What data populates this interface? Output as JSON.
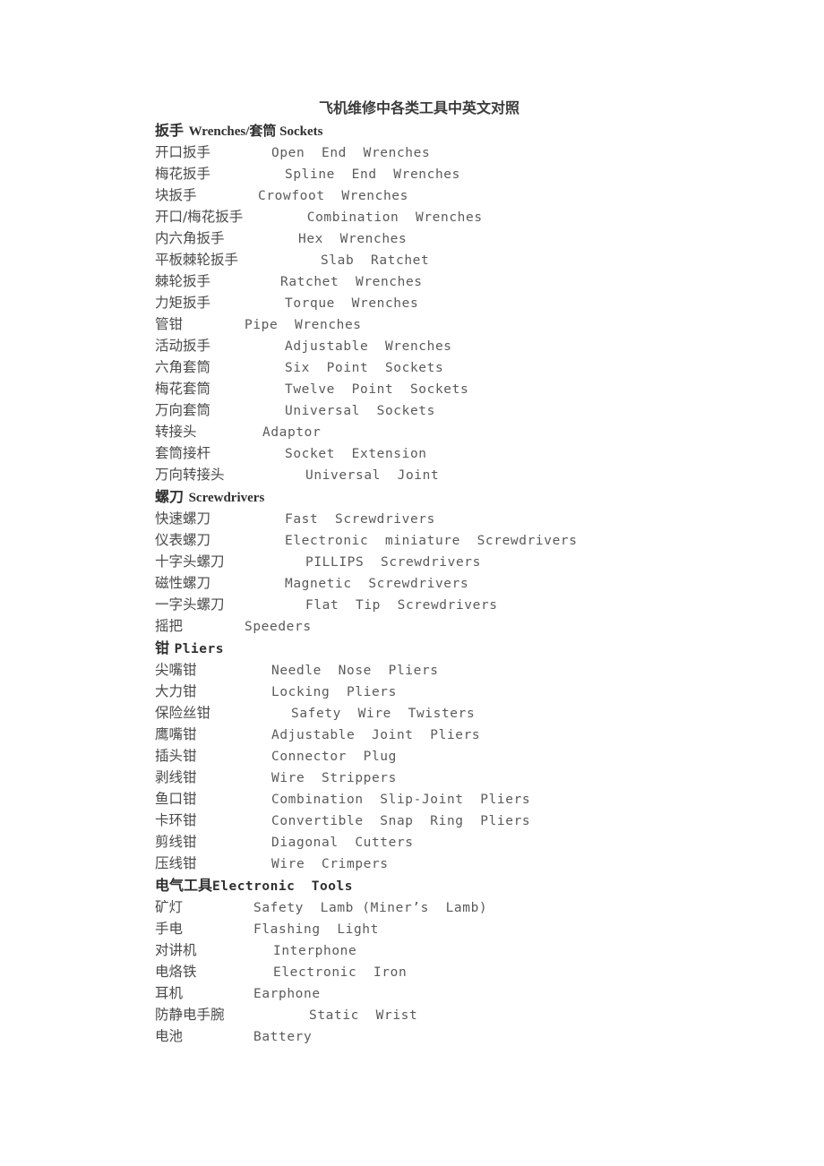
{
  "document": {
    "title": "飞机维修中各类工具中英文对照",
    "sections": [
      {
        "id": "wrenches-sockets",
        "heading_cn": "扳手 ",
        "heading_en": "Wrenches/套筒 Sockets",
        "heading_mono": false,
        "entries": [
          {
            "cn": "开口扳手",
            "en": "Open  End  Wrenches",
            "indent": 130
          },
          {
            "cn": "梅花扳手",
            "en": "Spline  End  Wrenches",
            "indent": 145
          },
          {
            "cn": "块扳手",
            "en": "Crowfoot  Wrenches",
            "indent": 115
          },
          {
            "cn": "开口/梅花扳手",
            "en": "Combination  Wrenches",
            "indent": 180
          },
          {
            "cn": "内六角扳手",
            "en": "Hex  Wrenches",
            "indent": 160
          },
          {
            "cn": "平板棘轮扳手",
            "en": "Slab  Ratchet",
            "indent": 185
          },
          {
            "cn": "棘轮扳手",
            "en": "Ratchet  Wrenches",
            "indent": 140
          },
          {
            "cn": "力矩扳手",
            "en": "Torque  Wrenches",
            "indent": 145
          },
          {
            "cn": "管钳",
            "en": "Pipe  Wrenches",
            "indent": 100
          },
          {
            "cn": "活动扳手",
            "en": "Adjustable  Wrenches",
            "indent": 145
          },
          {
            "cn": "六角套筒",
            "en": "Six  Point  Sockets",
            "indent": 145
          },
          {
            "cn": "梅花套筒",
            "en": "Twelve  Point  Sockets",
            "indent": 145
          },
          {
            "cn": "万向套筒",
            "en": "Universal  Sockets",
            "indent": 145
          },
          {
            "cn": "转接头",
            "en": "Adaptor",
            "indent": 120
          },
          {
            "cn": "套筒接杆",
            "en": "Socket  Extension",
            "indent": 145
          },
          {
            "cn": "万向转接头",
            "en": "Universal  Joint",
            "indent": 168
          }
        ]
      },
      {
        "id": "screwdrivers",
        "heading_cn": "螺刀 ",
        "heading_en": "Screwdrivers",
        "heading_mono": false,
        "entries": [
          {
            "cn": "快速螺刀",
            "en": "Fast  Screwdrivers",
            "indent": 145
          },
          {
            "cn": "仪表螺刀",
            "en": "Electronic  miniature  Screwdrivers",
            "indent": 145
          },
          {
            "cn": "十字头螺刀",
            "en": "PILLIPS  Screwdrivers",
            "indent": 168
          },
          {
            "cn": "磁性螺刀",
            "en": "Magnetic  Screwdrivers",
            "indent": 145
          },
          {
            "cn": "一字头螺刀",
            "en": "Flat  Tip  Screwdrivers",
            "indent": 168
          },
          {
            "cn": "摇把",
            "en": "Speeders",
            "indent": 100
          }
        ]
      },
      {
        "id": "pliers",
        "heading_cn": "钳 ",
        "heading_en": "Pliers",
        "heading_mono": true,
        "entries": [
          {
            "cn": "尖嘴钳",
            "en": "Needle  Nose  Pliers",
            "indent": 130
          },
          {
            "cn": "大力钳",
            "en": "Locking  Pliers",
            "indent": 130
          },
          {
            "cn": "保险丝钳",
            "en": "Safety  Wire  Twisters",
            "indent": 152
          },
          {
            "cn": "鹰嘴钳",
            "en": "Adjustable  Joint  Pliers",
            "indent": 130
          },
          {
            "cn": "插头钳",
            "en": "Connector  Plug",
            "indent": 130
          },
          {
            "cn": "剥线钳",
            "en": "Wire  Strippers",
            "indent": 130
          },
          {
            "cn": "鱼口钳",
            "en": "Combination  Slip-Joint  Pliers",
            "indent": 130
          },
          {
            "cn": "卡环钳",
            "en": "Convertible  Snap  Ring  Pliers",
            "indent": 130
          },
          {
            "cn": "剪线钳",
            "en": "Diagonal  Cutters",
            "indent": 130
          },
          {
            "cn": "压线钳",
            "en": "Wire  Crimpers",
            "indent": 130
          }
        ]
      },
      {
        "id": "electronic-tools",
        "heading_cn": "电气工具",
        "heading_en": "Electronic  Tools",
        "heading_mono": true,
        "entries": [
          {
            "cn": "矿灯",
            "en": "Safety  Lamb (Miner’s  Lamb)",
            "indent": 110
          },
          {
            "cn": "手电",
            "en": "Flashing  Light",
            "indent": 110
          },
          {
            "cn": "对讲机",
            "en": "Interphone",
            "indent": 132
          },
          {
            "cn": "电烙铁",
            "en": "Electronic  Iron",
            "indent": 132
          },
          {
            "cn": "耳机",
            "en": "Earphone",
            "indent": 110
          },
          {
            "cn": "防静电手腕",
            "en": "Static  Wrist",
            "indent": 172
          },
          {
            "cn": "电池",
            "en": "Battery",
            "indent": 110
          }
        ]
      }
    ]
  }
}
